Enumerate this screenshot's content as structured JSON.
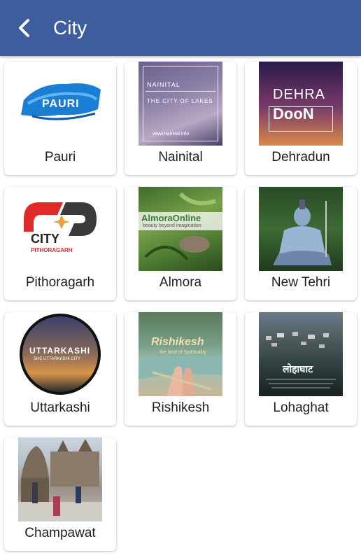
{
  "app_bar": {
    "title": "City",
    "back_icon": "chevron-left-icon",
    "color": "#3d5d9f"
  },
  "cities": [
    {
      "name": "Pauri",
      "thumb_text": [
        "PAURI"
      ]
    },
    {
      "name": "Nainital",
      "thumb_text": [
        "NAINITAL",
        "THE CITY OF LAKES",
        "www.nainital.info"
      ]
    },
    {
      "name": "Dehradun",
      "thumb_text": [
        "DEHRA",
        "DooN"
      ]
    },
    {
      "name": "Pithoragarh",
      "thumb_text": [
        "CITY",
        "PITHORAGARH"
      ]
    },
    {
      "name": "Almora",
      "thumb_text": [
        "AlmoraOnline",
        "beauty beyond imagination"
      ]
    },
    {
      "name": "New Tehri",
      "thumb_text": []
    },
    {
      "name": "Uttarkashi",
      "thumb_text": [
        "UTTARKASHI",
        "SHE UTTARKASHI CITY"
      ]
    },
    {
      "name": "Rishikesh",
      "thumb_text": [
        "Rishikesh",
        "the land of Spirituality"
      ]
    },
    {
      "name": "Lohaghat",
      "thumb_text": [
        "लोहाघाट"
      ]
    },
    {
      "name": "Champawat",
      "thumb_text": []
    }
  ]
}
